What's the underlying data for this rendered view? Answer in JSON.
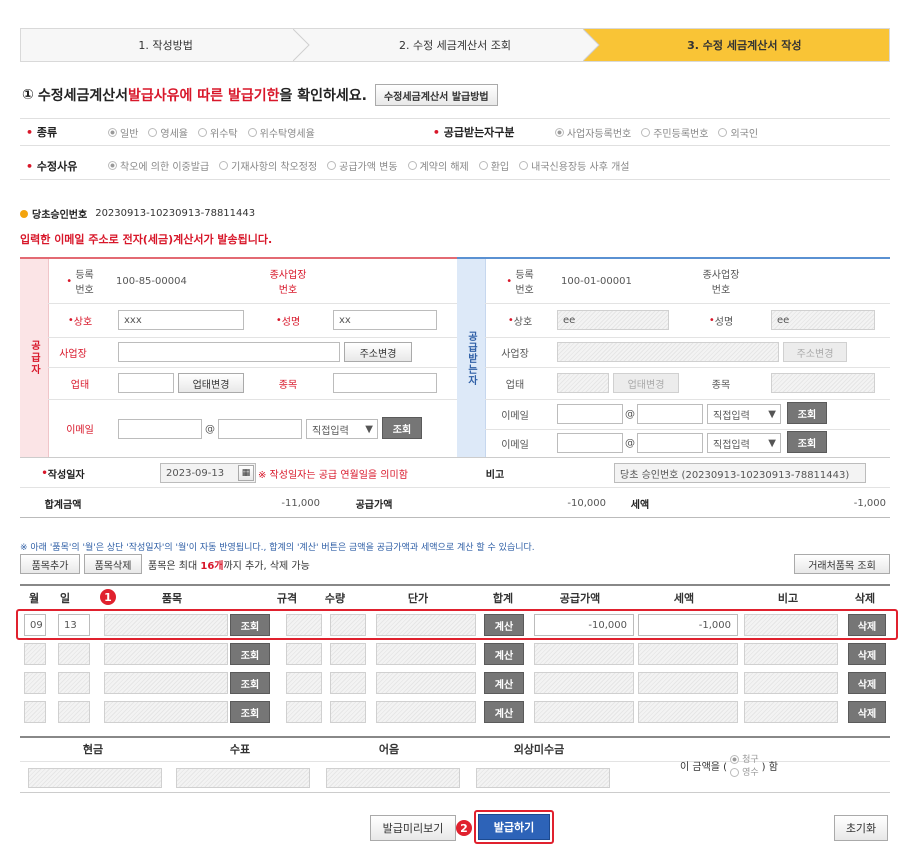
{
  "steps": [
    "1. 작성방법",
    "2. 수정 세금계산서 조회",
    "3. 수정 세금계산서 작성"
  ],
  "notice": {
    "icon": "①",
    "pre": "수정세금계산서 ",
    "red": "발급사유에 따른 발급기한",
    "post": "을 확인하세요.",
    "button": "수정세금계산서 발급방법"
  },
  "kind": {
    "label": "종류",
    "options": [
      "일반",
      "영세율",
      "위수탁",
      "위수탁영세율"
    ]
  },
  "recv_type": {
    "label": "공급받는자구분",
    "options": [
      "사업자등록번호",
      "주민등록번호",
      "외국인"
    ]
  },
  "reason": {
    "label": "수정사유",
    "options": [
      "착오에 의한 이중발급",
      "기재사항의 착오정정",
      "공급가액 변동",
      "계약의 해제",
      "환입",
      "내국신용장등 사후 개설"
    ]
  },
  "approval": {
    "label": "당초승인번호",
    "value": "20230913-10230913-78811443"
  },
  "email_notice": "입력한 이메일 주소로 전자(세금)계산서가 발송됩니다.",
  "supplier": {
    "side_label": "공급자",
    "reg_label": "등록\n번호",
    "reg_value": "100-85-00004",
    "sub_label": "종사업장\n번호",
    "name_label": "상호",
    "name_value": "xxx",
    "ceo_label": "성명",
    "ceo_value": "xx",
    "addr_label": "사업장",
    "addr_btn": "주소변경",
    "biz_label": "업태",
    "biz_btn": "업태변경",
    "item_label": "종목",
    "email_label": "이메일",
    "at": "@",
    "select": "직접입력",
    "search": "조회"
  },
  "receiver": {
    "side_label": "공급받는자",
    "reg_label": "등록\n번호",
    "reg_value": "100-01-00001",
    "sub_label": "종사업장\n번호",
    "name_label": "상호",
    "name_value": "ee",
    "ceo_label": "성명",
    "ceo_value": "ee",
    "addr_label": "사업장",
    "addr_btn": "주소변경",
    "biz_label": "업태",
    "biz_btn": "업태변경",
    "item_label": "종목",
    "email_label": "이메일",
    "at": "@",
    "select": "직접입력",
    "search": "조회"
  },
  "written": {
    "label": "작성일자",
    "date": "2023-09-13",
    "note": "※ 작성일자는 공급 연월일을 의미함",
    "memo_label": "비고",
    "memo_value": "당초 승인번호 (20230913-10230913-78811443)"
  },
  "totals": {
    "sum_label": "합계금액",
    "sum_value": "-11,000",
    "supply_label": "공급가액",
    "supply_value": "-10,000",
    "tax_label": "세액",
    "tax_value": "-1,000"
  },
  "items_note": "※ 아래 '품목'의 '월'은 상단 '작성일자'의 '월'이 자동 반영됩니다., 합계의 '계산' 버튼은 금액을 공급가액과 세액으로 계산 할 수 있습니다.",
  "items_toolbar": {
    "add": "품목추가",
    "del": "품목삭제",
    "limit_pre": "품목은 최대 ",
    "limit_bold": "16개",
    "limit_post": "까지 추가, 삭제 가능",
    "partner": "거래처품목 조회"
  },
  "items_headers": [
    "월",
    "일",
    "품목",
    "규격",
    "수량",
    "단가",
    "합계",
    "공급가액",
    "세액",
    "비고",
    "삭제"
  ],
  "items": [
    {
      "month": "09",
      "day": "13",
      "supply": "-10,000",
      "tax": "-1,000"
    },
    {
      "month": "",
      "day": "",
      "supply": "",
      "tax": ""
    },
    {
      "month": "",
      "day": "",
      "supply": "",
      "tax": ""
    },
    {
      "month": "",
      "day": "",
      "supply": "",
      "tax": ""
    }
  ],
  "row_buttons": {
    "search": "조회",
    "calc": "계산",
    "delete": "삭제"
  },
  "pay": {
    "headers": [
      "현금",
      "수표",
      "어음",
      "외상미수금"
    ],
    "amount_pre": "이 금액을 (",
    "opt1": "청구",
    "opt2": "영수",
    "amount_post": ") 함"
  },
  "bottom": {
    "preview": "발급미리보기",
    "issue": "발급하기",
    "reset": "초기화"
  },
  "badges": [
    "1",
    "2"
  ]
}
